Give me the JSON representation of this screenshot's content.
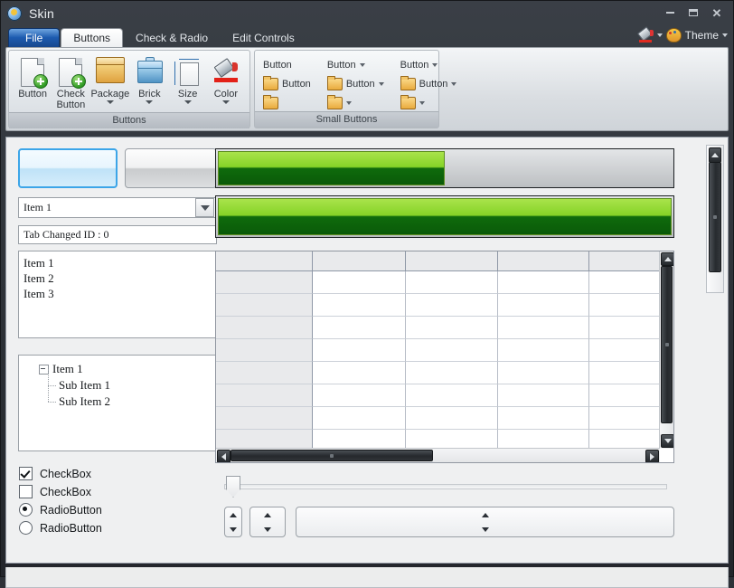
{
  "window": {
    "title": "Skin",
    "logo_icon": "app-logo-icon",
    "minimize_label": "Minimize",
    "maximize_label": "Maximize",
    "close_label": "Close"
  },
  "ribbon": {
    "tabs": [
      {
        "label": "File",
        "type": "file"
      },
      {
        "label": "Buttons",
        "type": "active"
      },
      {
        "label": "Check & Radio",
        "type": "plain"
      },
      {
        "label": "Edit Controls",
        "type": "plain"
      }
    ],
    "right": {
      "color_icon": "paint-bucket-icon",
      "theme_icon": "palette-icon",
      "theme_label": "Theme"
    },
    "groups": [
      {
        "caption": "Buttons",
        "launcher_icon": "dialog-launcher-icon",
        "buttons": [
          {
            "label": "Button",
            "icon": "page-add-icon",
            "has_caret": false
          },
          {
            "label": "Check Button",
            "icon": "page-add-icon",
            "has_caret": false
          },
          {
            "label": "Package",
            "icon": "package-box-icon",
            "has_caret": true
          },
          {
            "label": "Brick",
            "icon": "brick-icon",
            "has_caret": true
          },
          {
            "label": "Size",
            "icon": "size-page-icon",
            "has_caret": true
          },
          {
            "label": "Color",
            "icon": "color-bucket-icon",
            "has_caret": true
          }
        ]
      },
      {
        "caption": "Small Buttons",
        "launcher_icon": "dialog-launcher-icon",
        "columns": [
          [
            {
              "label": "Button",
              "icon": null,
              "has_caret": false
            },
            {
              "label": "Button",
              "icon": "folder-icon",
              "has_caret": false
            },
            {
              "label": "",
              "icon": "folder-icon",
              "has_caret": false
            }
          ],
          [
            {
              "label": "Button",
              "icon": null,
              "has_caret": true
            },
            {
              "label": "Button",
              "icon": "folder-icon",
              "has_caret": true
            },
            {
              "label": "",
              "icon": "folder-icon",
              "has_caret": true
            }
          ],
          [
            {
              "label": "Button",
              "icon": null,
              "has_caret": true
            },
            {
              "label": "Button",
              "icon": "folder-icon",
              "has_caret": true
            },
            {
              "label": "",
              "icon": "folder-icon",
              "has_caret": true
            }
          ]
        ]
      }
    ]
  },
  "client": {
    "buttons": [
      {
        "name": "selected-button",
        "state": "selected",
        "label": ""
      },
      {
        "name": "normal-button",
        "state": "normal",
        "label": ""
      }
    ],
    "combo": {
      "value": "Item 1",
      "dropdown_icon": "chevron-down-icon"
    },
    "status_field": {
      "value": "Tab Changed ID : 0"
    },
    "listbox": {
      "items": [
        "Item 1",
        "Item 2",
        "Item 3"
      ]
    },
    "treeview": {
      "root": "Item 1",
      "expander_icon": "collapse-minus-icon",
      "children": [
        "Sub Item 1",
        "Sub Item 2"
      ]
    },
    "checks": [
      {
        "type": "checkbox",
        "label": "CheckBox",
        "checked": true
      },
      {
        "type": "checkbox",
        "label": "CheckBox",
        "checked": false
      },
      {
        "type": "radio",
        "label": "RadioButton",
        "checked": true
      },
      {
        "type": "radio",
        "label": "RadioButton",
        "checked": false
      }
    ],
    "progress_bars": [
      {
        "name": "progress-bar-partial",
        "percent": 50
      },
      {
        "name": "progress-bar-full",
        "percent": 100
      }
    ],
    "grid": {
      "columns": 5,
      "rows": 8,
      "headers": [
        "",
        "",
        "",
        "",
        ""
      ],
      "cells": []
    },
    "slider": {
      "value": 0,
      "knob_icon": "slider-knob-icon"
    },
    "spinners": [
      {
        "name": "spin-narrow",
        "up_icon": "caret-up-icon",
        "down_icon": "caret-down-icon"
      },
      {
        "name": "spin-wide",
        "up_icon": "caret-up-icon",
        "down_icon": "caret-down-icon"
      },
      {
        "name": "spin-full",
        "up_icon": "caret-up-icon",
        "down_icon": "caret-down-icon"
      }
    ],
    "scrollbars": {
      "window_vertical": {
        "up_icon": "arrow-up-icon",
        "down_icon": "arrow-down-icon"
      },
      "grid_vertical": {
        "up_icon": "arrow-up-icon",
        "down_icon": "arrow-down-icon"
      },
      "grid_horizontal": {
        "left_icon": "arrow-left-icon",
        "right_icon": "arrow-right-icon"
      }
    }
  },
  "colors": {
    "accent_blue": "#1d5bb0",
    "progress_green_light": "#86d327",
    "progress_green_dark": "#0f6b0c",
    "selection_border": "#3ca5e8",
    "titlebar_dark": "#2e3238"
  }
}
